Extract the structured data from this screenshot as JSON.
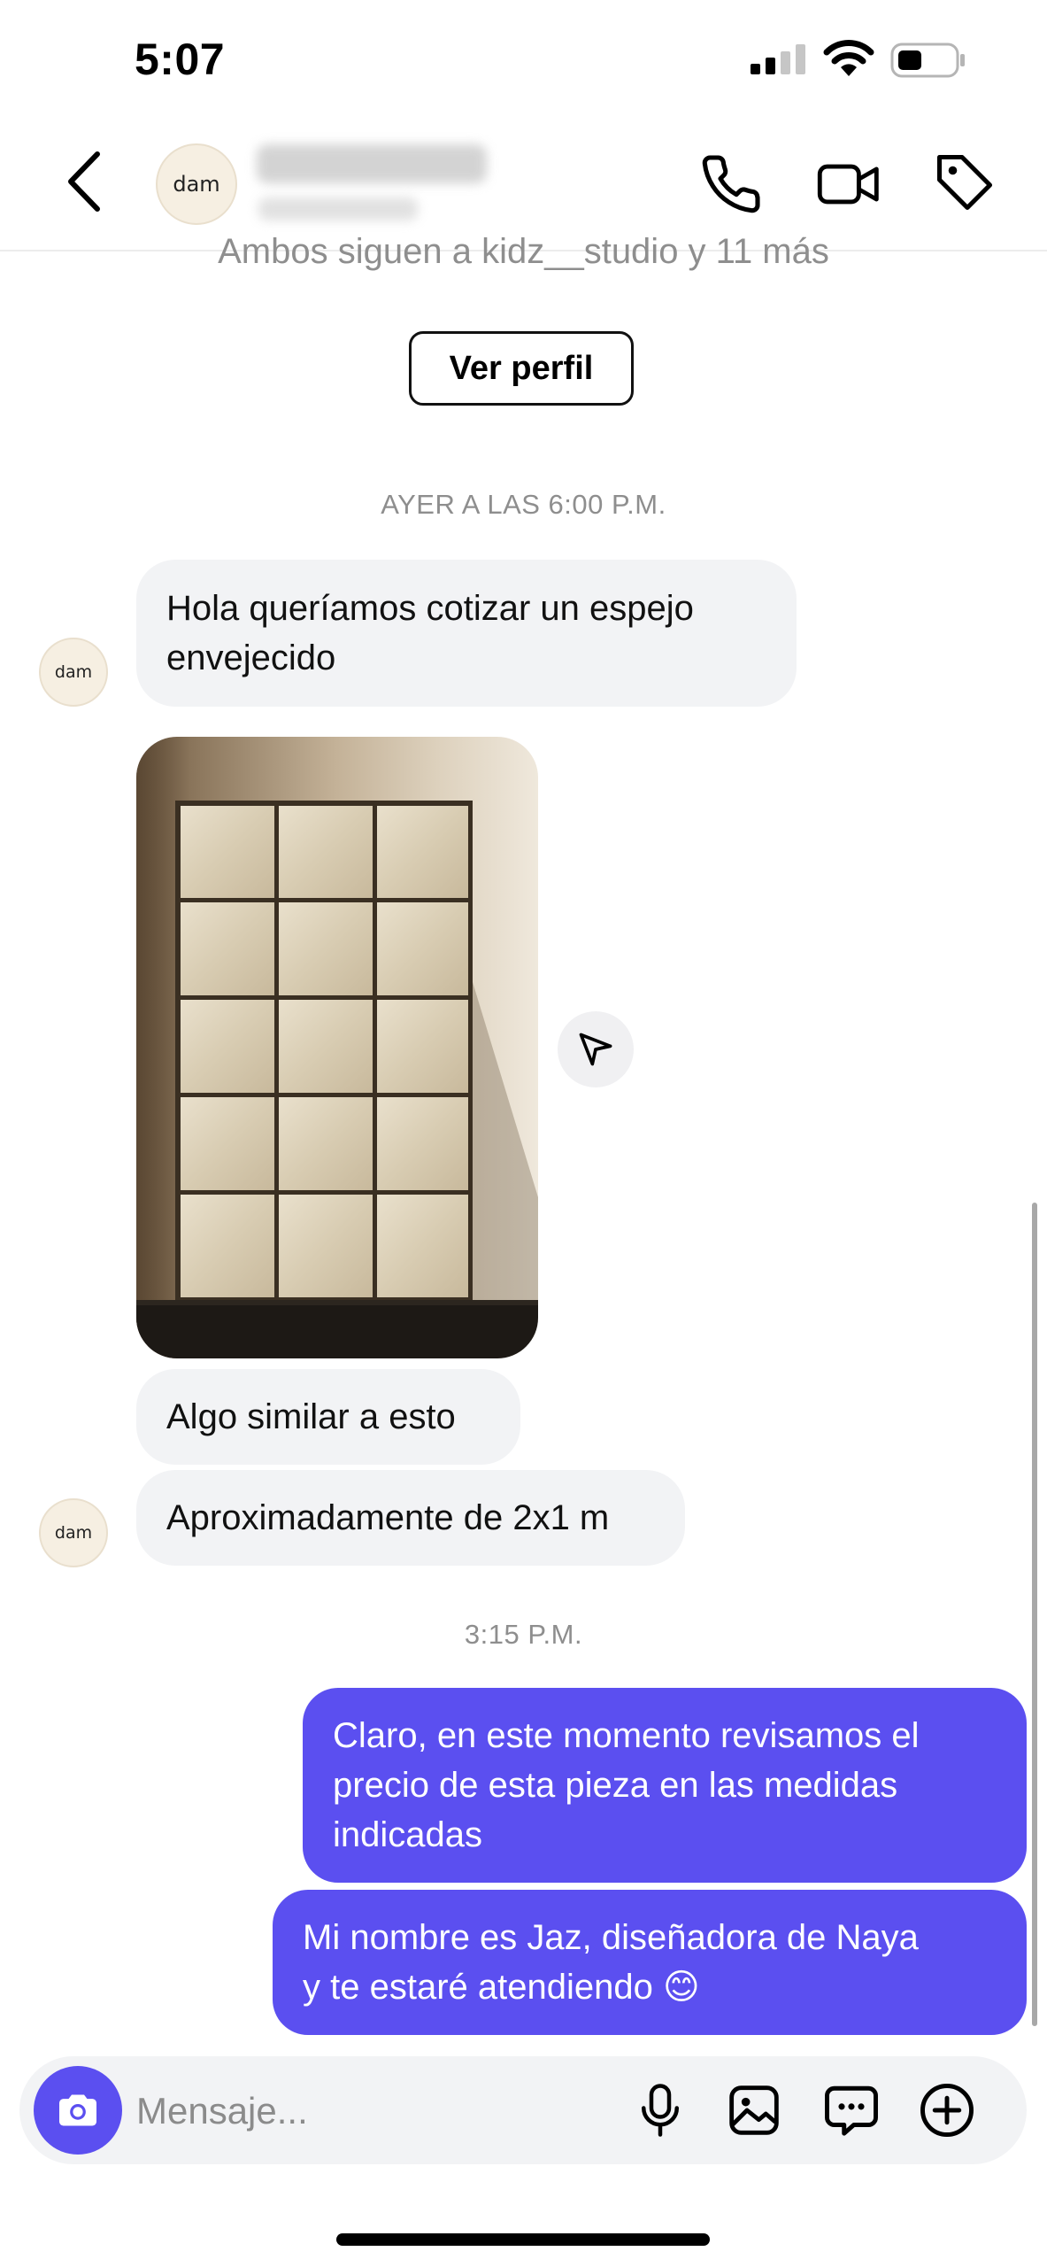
{
  "status_bar": {
    "time": "5:07"
  },
  "header": {
    "avatar_text": "dam",
    "icons": [
      "back-icon",
      "phone-icon",
      "video-camera-icon",
      "tag-icon"
    ]
  },
  "profile_info": {
    "followers_text": "Ambos siguen a kidz__studio y 11 más",
    "view_profile_label": "Ver perfil"
  },
  "conversation": {
    "timestamp_1": "AYER A LAS 6:00 P.M.",
    "incoming_1_line1": "Hola queríamos cotizar un espejo",
    "incoming_1_line2": "envejecido",
    "incoming_2": "Algo similar a esto",
    "incoming_3": "Aproximadamente de 2x1 m",
    "timestamp_2": "3:15 P.M.",
    "outgoing_1_line1": "Claro, en este momento revisamos el",
    "outgoing_1_line2": "precio de esta pieza en las medidas",
    "outgoing_1_line3": "indicadas",
    "outgoing_2_line1": "Mi nombre es Jaz, diseñadora de Naya",
    "outgoing_2_line2": "y te estaré atendiendo 😊"
  },
  "composer": {
    "placeholder": "Mensaje...",
    "icons": [
      "camera-icon",
      "microphone-icon",
      "gallery-icon",
      "sticker-icon",
      "plus-icon"
    ]
  },
  "colors": {
    "accent": "#5b4ff0",
    "incoming_bubble": "#f2f3f5",
    "muted_text": "#8e8e8e"
  }
}
